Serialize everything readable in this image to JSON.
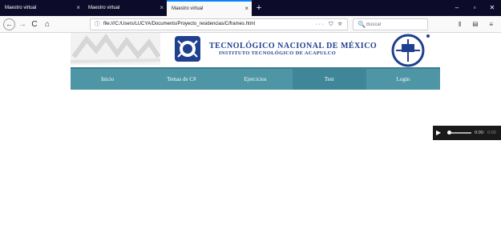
{
  "browser": {
    "tabs": [
      {
        "title": "Maestro virtual",
        "close": "×"
      },
      {
        "title": "Maestro virtual",
        "close": "×"
      },
      {
        "title": "Maestro virtual",
        "close": "×"
      }
    ],
    "new_tab": "+",
    "window_controls": {
      "minimize": "–",
      "maximize": "▫",
      "close": "✕"
    },
    "nav": {
      "back": "←",
      "forward": "→",
      "reload": "C",
      "home": "⌂"
    },
    "url": "file:///C:/Users/LUCYA/Documents/Proyecto_residencias/C/frames.html",
    "url_info": "ⓘ",
    "url_actions": "··· ⛉ ☆",
    "search": {
      "icon": "🔍",
      "placeholder": "Buscar"
    },
    "toolbar_right": "⫴ ▤ ≡"
  },
  "header": {
    "title": "TECNOLÓGICO NACIONAL DE MÉXICO",
    "subtitle": "INSTITUTO TECNOLÓGICO DE ACAPULCO"
  },
  "menu": {
    "items": [
      {
        "label": "Inicio"
      },
      {
        "label": "Temas de C#"
      },
      {
        "label": "Ejercicios"
      },
      {
        "label": "Test"
      },
      {
        "label": "Login"
      }
    ],
    "active_index": 3
  },
  "audio": {
    "play": "▶",
    "current_time": "0:00",
    "separator": "/",
    "duration": "0:00"
  },
  "colors": {
    "tabbar": "#0c0c2a",
    "menu": "#4e95a5",
    "brand_blue": "#1f3f8f"
  }
}
